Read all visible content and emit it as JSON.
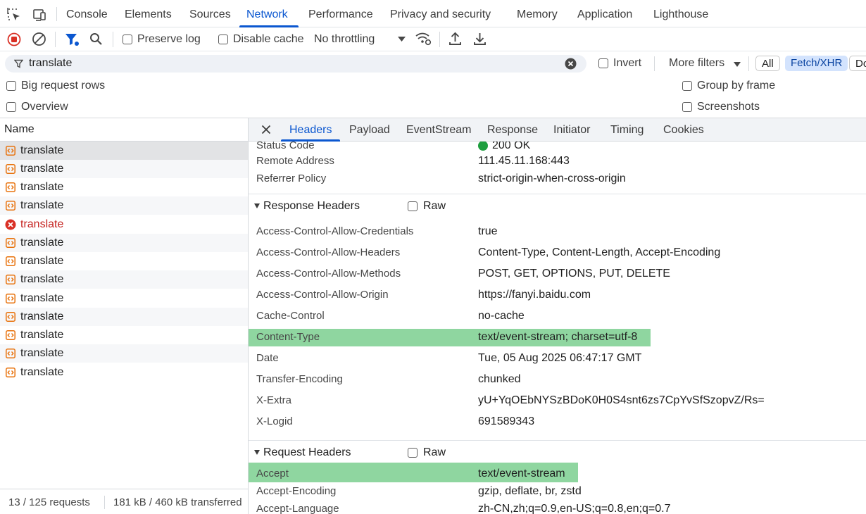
{
  "top_tabs": [
    {
      "label": "Console",
      "active": false
    },
    {
      "label": "Elements",
      "active": false
    },
    {
      "label": "Sources",
      "active": false
    },
    {
      "label": "Network",
      "active": true
    },
    {
      "label": "Performance",
      "active": false
    },
    {
      "label": "Privacy and security",
      "active": false
    },
    {
      "label": "Memory",
      "active": false
    },
    {
      "label": "Application",
      "active": false
    },
    {
      "label": "Lighthouse",
      "active": false
    }
  ],
  "toolbar": {
    "preserve_log": "Preserve log",
    "disable_cache": "Disable cache",
    "throttling": "No throttling"
  },
  "filter": {
    "value": "translate",
    "invert": "Invert",
    "more_filters": "More filters",
    "chip_all": "All",
    "chip_fetch": "Fetch/XHR",
    "chip_doc": "Doc"
  },
  "options": {
    "big_rows": "Big request rows",
    "overview": "Overview",
    "group_by_frame": "Group by frame",
    "screenshots": "Screenshots"
  },
  "list": {
    "header": "Name",
    "rows": [
      {
        "name": "translate",
        "error": false
      },
      {
        "name": "translate",
        "error": false
      },
      {
        "name": "translate",
        "error": false
      },
      {
        "name": "translate",
        "error": false
      },
      {
        "name": "translate",
        "error": true
      },
      {
        "name": "translate",
        "error": false
      },
      {
        "name": "translate",
        "error": false
      },
      {
        "name": "translate",
        "error": false
      },
      {
        "name": "translate",
        "error": false
      },
      {
        "name": "translate",
        "error": false
      },
      {
        "name": "translate",
        "error": false
      },
      {
        "name": "translate",
        "error": false
      },
      {
        "name": "translate",
        "error": false
      }
    ],
    "footer_requests": "13 / 125 requests",
    "footer_transferred": "181 kB / 460 kB transferred"
  },
  "detail_tabs": [
    {
      "label": "Headers",
      "active": true
    },
    {
      "label": "Payload",
      "active": false
    },
    {
      "label": "EventStream",
      "active": false
    },
    {
      "label": "Response",
      "active": false
    },
    {
      "label": "Initiator",
      "active": false
    },
    {
      "label": "Timing",
      "active": false
    },
    {
      "label": "Cookies",
      "active": false
    }
  ],
  "general": {
    "status_code_name": "Status Code",
    "status_code_value": "200 OK",
    "remote_address_name": "Remote Address",
    "remote_address_value": "111.45.11.168:443",
    "referrer_policy_name": "Referrer Policy",
    "referrer_policy_value": "strict-origin-when-cross-origin"
  },
  "response_headers": {
    "title": "Response Headers",
    "raw": "Raw",
    "items": [
      {
        "name": "Access-Control-Allow-Credentials",
        "value": "true"
      },
      {
        "name": "Access-Control-Allow-Headers",
        "value": "Content-Type, Content-Length, Accept-Encoding"
      },
      {
        "name": "Access-Control-Allow-Methods",
        "value": "POST, GET, OPTIONS, PUT, DELETE"
      },
      {
        "name": "Access-Control-Allow-Origin",
        "value": "https://fanyi.baidu.com"
      },
      {
        "name": "Cache-Control",
        "value": "no-cache"
      },
      {
        "name": "Content-Type",
        "value": "text/event-stream; charset=utf-8"
      },
      {
        "name": "Date",
        "value": "Tue, 05 Aug 2025 06:47:17 GMT"
      },
      {
        "name": "Transfer-Encoding",
        "value": "chunked"
      },
      {
        "name": "X-Extra",
        "value": "yU+YqOEbNYSzBDoK0H0S4snt6zs7CpYvSfSzopvZ/Rs="
      },
      {
        "name": "X-Logid",
        "value": "691589343"
      }
    ]
  },
  "request_headers": {
    "title": "Request Headers",
    "raw": "Raw",
    "items": [
      {
        "name": "Accept",
        "value": "text/event-stream"
      },
      {
        "name": "Accept-Encoding",
        "value": "gzip, deflate, br, zstd"
      },
      {
        "name": "Accept-Language",
        "value": "zh-CN,zh;q=0.9,en-US;q=0.8,en;q=0.7"
      }
    ]
  },
  "colors": {
    "accent": "#0b57d0",
    "highlight": "#8fd6a0",
    "error": "#c5221f",
    "status_ok": "#1e9e3e"
  }
}
